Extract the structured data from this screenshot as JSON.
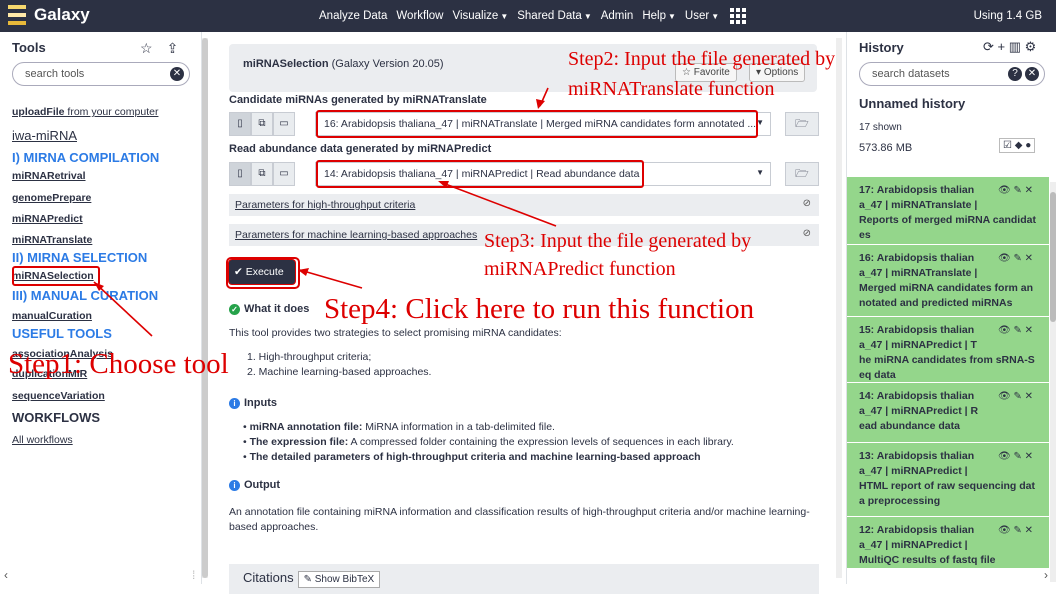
{
  "masthead": {
    "brand": "Galaxy",
    "nav": [
      {
        "label": "Analyze Data"
      },
      {
        "label": "Workflow"
      },
      {
        "label": "Visualize",
        "dd": true
      },
      {
        "label": "Shared Data",
        "dd": true
      },
      {
        "label": "Admin"
      },
      {
        "label": "Help",
        "dd": true
      },
      {
        "label": "User",
        "dd": true
      }
    ],
    "usage": "Using 1.4 GB"
  },
  "tools": {
    "title": "Tools",
    "search_placeholder": "search tools",
    "upload_link": "uploadFile",
    "upload_rest": " from your computer",
    "section": "iwa-miRNA",
    "items": [
      {
        "t": "sec",
        "label": "I) MIRNA COMPILATION"
      },
      {
        "t": "link",
        "label": "miRNARetrival"
      },
      {
        "t": "link",
        "label": "genomePrepare"
      },
      {
        "t": "link",
        "label": "miRNAPredict"
      },
      {
        "t": "link",
        "label": "miRNATranslate"
      },
      {
        "t": "sec",
        "label": "II) MIRNA SELECTION"
      },
      {
        "t": "link",
        "label": "miRNASelection"
      },
      {
        "t": "sec",
        "label": "III) MANUAL CURATION"
      },
      {
        "t": "link",
        "label": "manualCuration"
      },
      {
        "t": "sec",
        "label": "USEFUL TOOLS"
      },
      {
        "t": "link",
        "label": "associationAnalysis"
      },
      {
        "t": "link",
        "label": "duplicationMIR"
      },
      {
        "t": "link",
        "label": "sequenceVariation"
      }
    ],
    "workflows": "WORKFLOWS",
    "all_workflows": "All workflows"
  },
  "tool": {
    "name": "miRNASelection",
    "version": "(Galaxy Version 20.05)",
    "favorite": "Favorite",
    "options": "Options",
    "input1_label": "Candidate miRNAs generated by miRNATranslate",
    "input1_value": "16: Arabidopsis thaliana_47 | miRNATranslate | Merged miRNA candidates form annotated ...",
    "input2_label": "Read abundance data generated by miRNAPredict",
    "input2_value": "14: Arabidopsis thaliana_47 | miRNAPredict | Read abundance data",
    "param1": "Parameters for high-throughput criteria",
    "param2": "Parameters for machine learning-based approaches",
    "execute": "Execute",
    "what_title": "What it does",
    "what_text": "This tool provides two strategies to select promising miRNA candidates:",
    "what_items": [
      "1. High-throughput criteria;",
      "2. Machine learning-based approaches."
    ],
    "inputs_title": "Inputs",
    "inputs_items": [
      {
        "b": "miRNA annotation file:",
        "t": " MiRNA information in a tab-delimited file."
      },
      {
        "b": "The expression file:",
        "t": " A compressed folder containing the expression levels of sequences in each library."
      },
      {
        "b": "The detailed parameters of high-throughput criteria and machine learning-based approach",
        "t": ""
      }
    ],
    "output_title": "Output",
    "output_text": "An annotation file containing miRNA information and classification results of high-throughput criteria and/or machine learning-based approaches.",
    "citations": "Citations",
    "bibtex": "Show BibTeX"
  },
  "history": {
    "title": "History",
    "search_placeholder": "search datasets",
    "name": "Unnamed history",
    "shown": "17 shown",
    "size": "573.86 MB",
    "datasets": [
      {
        "l1": "17: Arabidopsis thalian",
        "l2": "a_47 | miRNATranslate |",
        "l3": "Reports of merged miRNA candidat",
        "l4": "es"
      },
      {
        "l1": "16: Arabidopsis thalian",
        "l2": "a_47 | miRNATranslate |",
        "l3": "Merged miRNA candidates form an",
        "l4": "notated and predicted miRNAs"
      },
      {
        "l1": "15: Arabidopsis thalian",
        "l2": "a_47 | miRNAPredict | T",
        "l3": "he miRNA candidates from sRNA-S",
        "l4": "eq data"
      },
      {
        "l1": "14: Arabidopsis thalian",
        "l2": "a_47 | miRNAPredict | R",
        "l3": "ead abundance data",
        "l4": ""
      },
      {
        "l1": "13: Arabidopsis thalian",
        "l2": "a_47 | miRNAPredict |",
        "l3": "HTML report of raw sequencing dat",
        "l4": "a preprocessing"
      },
      {
        "l1": "12: Arabidopsis thalian",
        "l2": "a_47 | miRNAPredict |",
        "l3": "MultiQC results of fastq file",
        "l4": ""
      }
    ]
  },
  "annotations": {
    "step1": "Step1: Choose tool",
    "step2a": "Step2: Input the file generated by",
    "step2b": "miRNATranslate function",
    "step3a": "Step3: Input the file generated by",
    "step3b": "miRNAPredict function",
    "step4": "Step4: Click here to run this function",
    "color": "#dd0000"
  }
}
